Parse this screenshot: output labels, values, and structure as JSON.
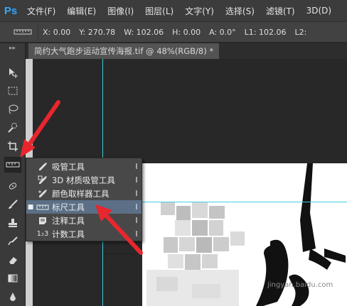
{
  "app": {
    "logo": "Ps"
  },
  "menu": [
    "文件(F)",
    "编辑(E)",
    "图像(I)",
    "图层(L)",
    "文字(Y)",
    "选择(S)",
    "滤镜(T)",
    "3D(D)"
  ],
  "options": {
    "x": "X: 0.00",
    "y": "Y: 270.78",
    "w": "W: 102.06",
    "h": "H: 0.00",
    "a": "A: 0.0°",
    "l1": "L1: 102.06",
    "l2": "L2:"
  },
  "document": {
    "tab_title": "简约大气跑步运动宣传海报.tif @ 48%(RGB/8) *"
  },
  "flyout": {
    "items": [
      {
        "label": "吸管工具",
        "shortcut": "I",
        "icon": "eyedropper-icon",
        "selected": false
      },
      {
        "label": "3D 材质吸管工具",
        "shortcut": "I",
        "icon": "3d-material-eyedropper-icon",
        "selected": false
      },
      {
        "label": "颜色取样器工具",
        "shortcut": "I",
        "icon": "color-sampler-icon",
        "selected": false
      },
      {
        "label": "标尺工具",
        "shortcut": "I",
        "icon": "ruler-icon",
        "selected": true
      },
      {
        "label": "注释工具",
        "shortcut": "I",
        "icon": "note-icon",
        "selected": false
      },
      {
        "label": "计数工具",
        "shortcut": "I",
        "icon": "count-icon",
        "selected": false
      }
    ]
  },
  "count_icon_text": "1₂3",
  "watermark": "jingyan.baidu.com",
  "colors": {
    "accent_arrow": "#e8262d",
    "selected_item": "#5b6f86",
    "guide": "#3fd0e0",
    "logo": "#31a8ff"
  }
}
